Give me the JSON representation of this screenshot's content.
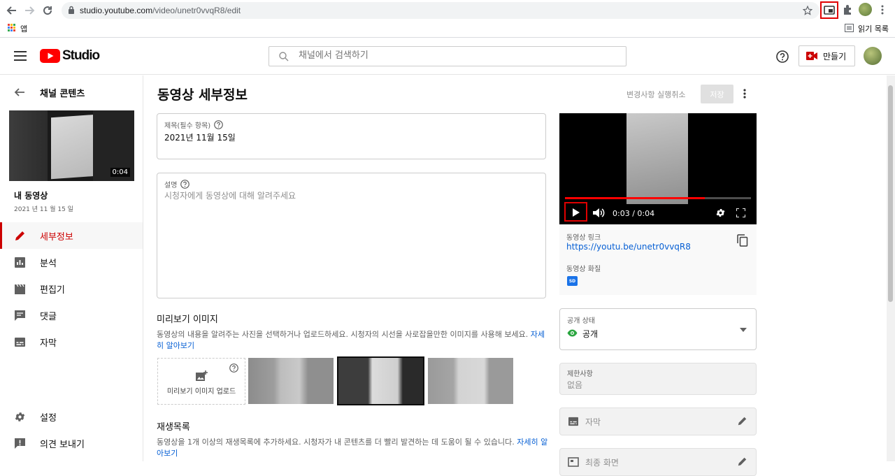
{
  "browser": {
    "url_host": "studio.youtube.com",
    "url_path": "/video/unetr0vvqR8/edit",
    "bookmark_apps": "앱",
    "reading_list": "읽기 목록"
  },
  "header": {
    "logo_text": "Studio",
    "search_placeholder": "채널에서 검색하기",
    "create_label": "만들기"
  },
  "sidebar": {
    "back_title": "채널 콘텐츠",
    "video_duration": "0:04",
    "my_video": "내 동영상",
    "video_date": "2021 년 11 월 15 일",
    "items": [
      {
        "label": "세부정보",
        "icon": "pencil-icon"
      },
      {
        "label": "분석",
        "icon": "analytics-icon"
      },
      {
        "label": "편집기",
        "icon": "clapper-icon"
      },
      {
        "label": "댓글",
        "icon": "comment-icon"
      },
      {
        "label": "자막",
        "icon": "subtitles-icon"
      }
    ],
    "settings": "설정",
    "feedback": "의견 보내기"
  },
  "main": {
    "page_title": "동영상 세부정보",
    "undo_label": "변경사항 실행취소",
    "save_label": "저장",
    "title_label": "제목(필수 항목)",
    "title_value": "2021년 11월 15일",
    "desc_label": "설명",
    "desc_placeholder": "시청자에게 동영상에 대해 알려주세요",
    "thumb_title": "미리보기 이미지",
    "thumb_desc": "동영상의 내용을 알려주는 사진을 선택하거나 업로드하세요. 시청자의 시선을 사로잡을만한 이미지를 사용해 보세요.",
    "thumb_link1": "자세",
    "thumb_link2": "히 알아보기",
    "thumb_upload": "미리보기 이미지 업로드",
    "playlist_title": "재생목록",
    "playlist_desc": "동영상을 1개 이상의 재생목록에 추가하세요. 시청자가 내 콘텐츠를 더 빨리 발견하는 데 도움이 될 수 있습니다.",
    "playlist_link1": "자세히 알",
    "playlist_link2": "아보기"
  },
  "player": {
    "time": "0:03 / 0:04",
    "progress": 0.75
  },
  "right": {
    "link_label": "동영상 링크",
    "link_value": "https://youtu.be/unetr0vvqR8",
    "quality_label": "동영상 화질",
    "quality_badge": "SD",
    "visibility_label": "공개 상태",
    "visibility_value": "공개",
    "restrictions_label": "제한사항",
    "restrictions_value": "없음",
    "subtitles_label": "자막",
    "endscreen_label": "최종 화면"
  },
  "colors": {
    "accent_red": "#cc0000",
    "link_blue": "#065fd4",
    "visibility_green": "#2ba640"
  }
}
